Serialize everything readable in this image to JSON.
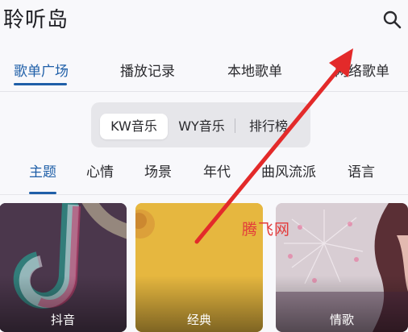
{
  "app": {
    "title": "聆听岛"
  },
  "icons": {
    "search": "search-icon"
  },
  "tabs": [
    {
      "label": "歌单广场",
      "active": true
    },
    {
      "label": "播放记录",
      "active": false
    },
    {
      "label": "本地歌单",
      "active": false
    },
    {
      "label": "网络歌单",
      "active": false
    }
  ],
  "sources": [
    {
      "label": "KW音乐",
      "selected": true
    },
    {
      "label": "WY音乐",
      "selected": false
    },
    {
      "label": "排行榜",
      "selected": false
    }
  ],
  "categories": [
    {
      "label": "主题",
      "active": true
    },
    {
      "label": "心情",
      "active": false
    },
    {
      "label": "场景",
      "active": false
    },
    {
      "label": "年代",
      "active": false
    },
    {
      "label": "曲风流派",
      "active": false
    },
    {
      "label": "语言",
      "active": false
    }
  ],
  "cards": [
    {
      "label": "抖音"
    },
    {
      "label": "经典"
    },
    {
      "label": "情歌"
    }
  ],
  "watermark": "腾飞网",
  "colors": {
    "accent": "#1f5fa8",
    "annotation": "#e32a2a",
    "card_yellow": "#e6b73f"
  }
}
